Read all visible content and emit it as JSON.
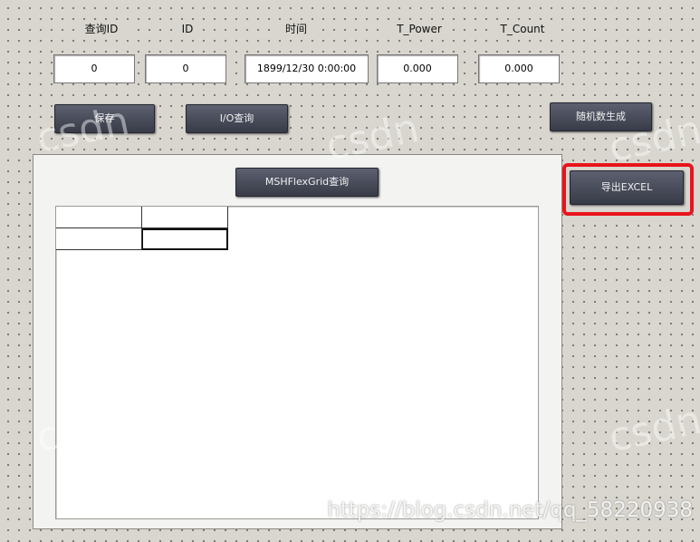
{
  "labels": {
    "query_id": "查询ID",
    "id": "ID",
    "time": "时间",
    "t_power": "T_Power",
    "t_count": "T_Count"
  },
  "fields": {
    "query_id": "0",
    "id": "0",
    "time": "1899/12/30 0:00:00",
    "t_power": "0.000",
    "t_count": "0.000"
  },
  "buttons": {
    "save": "保存",
    "io_query": "I/O查询",
    "random_generate": "随机数生成",
    "msh_query": "MSHFlexGrid查询",
    "export_excel": "导出EXCEL"
  },
  "watermark": {
    "brand": "csdn",
    "url": "https://blog.csdn.net/qq_58220938"
  },
  "colors": {
    "highlight": "#e8141c",
    "button": "#454854"
  }
}
